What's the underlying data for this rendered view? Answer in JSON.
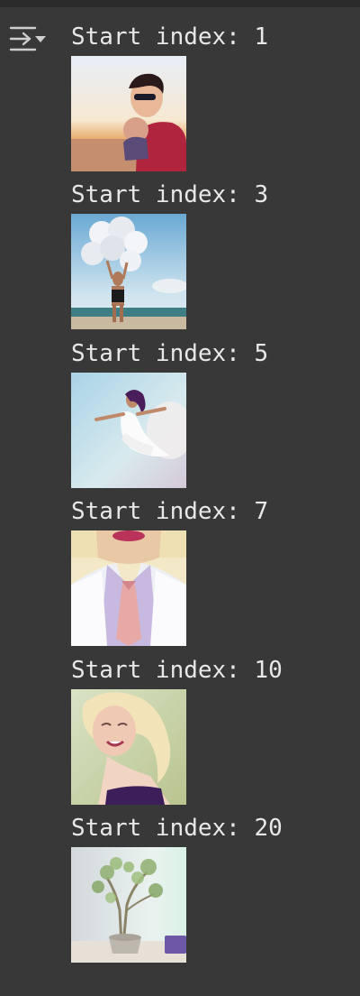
{
  "gutter": {
    "toggle_icon": "collapse-output-icon"
  },
  "outputs": [
    {
      "label": "Start index: 1",
      "image": "man with sunglasses holding a baby on a beach at sunset"
    },
    {
      "label": "Start index: 3",
      "image": "man on beach holding a bunch of white balloons"
    },
    {
      "label": "Start index: 5",
      "image": "woman in white dress leaping in the air"
    },
    {
      "label": "Start index: 7",
      "image": "close-up of man in white shirt and pink tie"
    },
    {
      "label": "Start index: 10",
      "image": "smiling blonde woman with curly hair"
    },
    {
      "label": "Start index: 20",
      "image": "small potted tree on a table"
    }
  ],
  "colors": {
    "background": "#383838",
    "text": "#e8e8e8",
    "icon": "#cfcfcf"
  }
}
